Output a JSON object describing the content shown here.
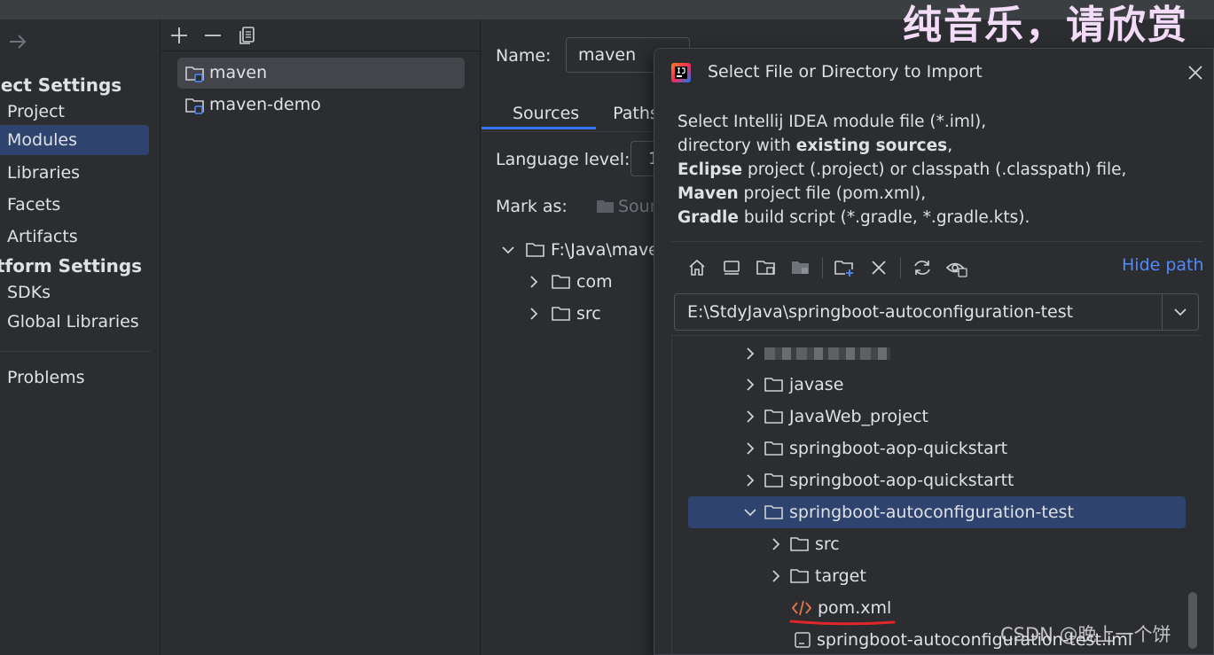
{
  "watermark_top": "纯音乐，请欣赏",
  "watermark_bottom": "CSDN @晚上一个饼",
  "sidebar": {
    "project_settings_header": "ject Settings",
    "project_items": [
      {
        "label": "Project"
      },
      {
        "label": "Modules",
        "selected": true
      },
      {
        "label": "Libraries"
      },
      {
        "label": "Facets"
      },
      {
        "label": "Artifacts"
      }
    ],
    "platform_settings_header": "tform Settings",
    "platform_items": [
      {
        "label": "SDKs"
      },
      {
        "label": "Global Libraries"
      }
    ],
    "problems_label": "Problems"
  },
  "modules": {
    "items": [
      {
        "label": "maven",
        "selected": true
      },
      {
        "label": "maven-demo"
      }
    ]
  },
  "module_settings": {
    "name_label": "Name:",
    "name_value": "maven",
    "tabs": [
      {
        "label": "Sources",
        "selected": true
      },
      {
        "label": "Paths"
      }
    ],
    "language_level_label": "Language level:",
    "language_level_value": "1",
    "mark_as_label": "Mark as:",
    "mark_as_sources": "Sour",
    "content_root": "F:\\Java\\mave",
    "tree": [
      {
        "label": "com"
      },
      {
        "label": "src"
      }
    ]
  },
  "dialog": {
    "title": "Select File or Directory to Import",
    "description": {
      "line1": "Select Intellij IDEA module file (*.iml),",
      "line2_pre": "directory with ",
      "line2_bold": "existing sources",
      "line2_post": ",",
      "line3_bold": "Eclipse",
      "line3_post": " project (.project) or classpath (.classpath) file,",
      "line4_bold": "Maven",
      "line4_post": " project file (pom.xml),",
      "line5_bold": "Gradle",
      "line5_post": " build script (*.gradle, *.gradle.kts)."
    },
    "hide_path_label": "Hide path",
    "path_value": "E:\\StdyJava\\springboot-autoconfiguration-test",
    "tree": [
      {
        "label": "",
        "type": "folder",
        "blurred": true,
        "expanded": false,
        "depth": 0
      },
      {
        "label": "javase",
        "type": "folder",
        "expanded": false,
        "depth": 0
      },
      {
        "label": "JavaWeb_project",
        "type": "folder",
        "expanded": false,
        "depth": 0
      },
      {
        "label": "springboot-aop-quickstart",
        "type": "folder",
        "expanded": false,
        "depth": 0
      },
      {
        "label": "springboot-aop-quickstartt",
        "type": "folder",
        "expanded": false,
        "depth": 0
      },
      {
        "label": "springboot-autoconfiguration-test",
        "type": "folder",
        "expanded": true,
        "selected": true,
        "depth": 0
      },
      {
        "label": "src",
        "type": "folder",
        "expanded": false,
        "depth": 1
      },
      {
        "label": "target",
        "type": "folder",
        "expanded": false,
        "depth": 1
      },
      {
        "label": "pom.xml",
        "type": "xml",
        "depth": 1
      },
      {
        "label": "springboot-autoconfiguration-test.iml",
        "type": "iml",
        "depth": 1
      }
    ]
  },
  "colors": {
    "background": "#2b2d30",
    "selection": "#2e436e",
    "accent_link": "#548af7",
    "annotation_underline": "#e0262a",
    "xml_icon": "#e8754a"
  },
  "icons": [
    "arrow-right-icon",
    "add-icon",
    "remove-icon",
    "copy-icon",
    "module-folder-icon",
    "folder-icon",
    "intellij-logo-icon",
    "close-icon",
    "home-icon",
    "desktop-icon",
    "project-folder-icon",
    "module-dir-icon",
    "new-folder-icon",
    "delete-icon",
    "refresh-icon",
    "show-hidden-icon",
    "chevron-down-icon",
    "chevron-right-icon",
    "xml-file-icon",
    "iml-file-icon"
  ]
}
